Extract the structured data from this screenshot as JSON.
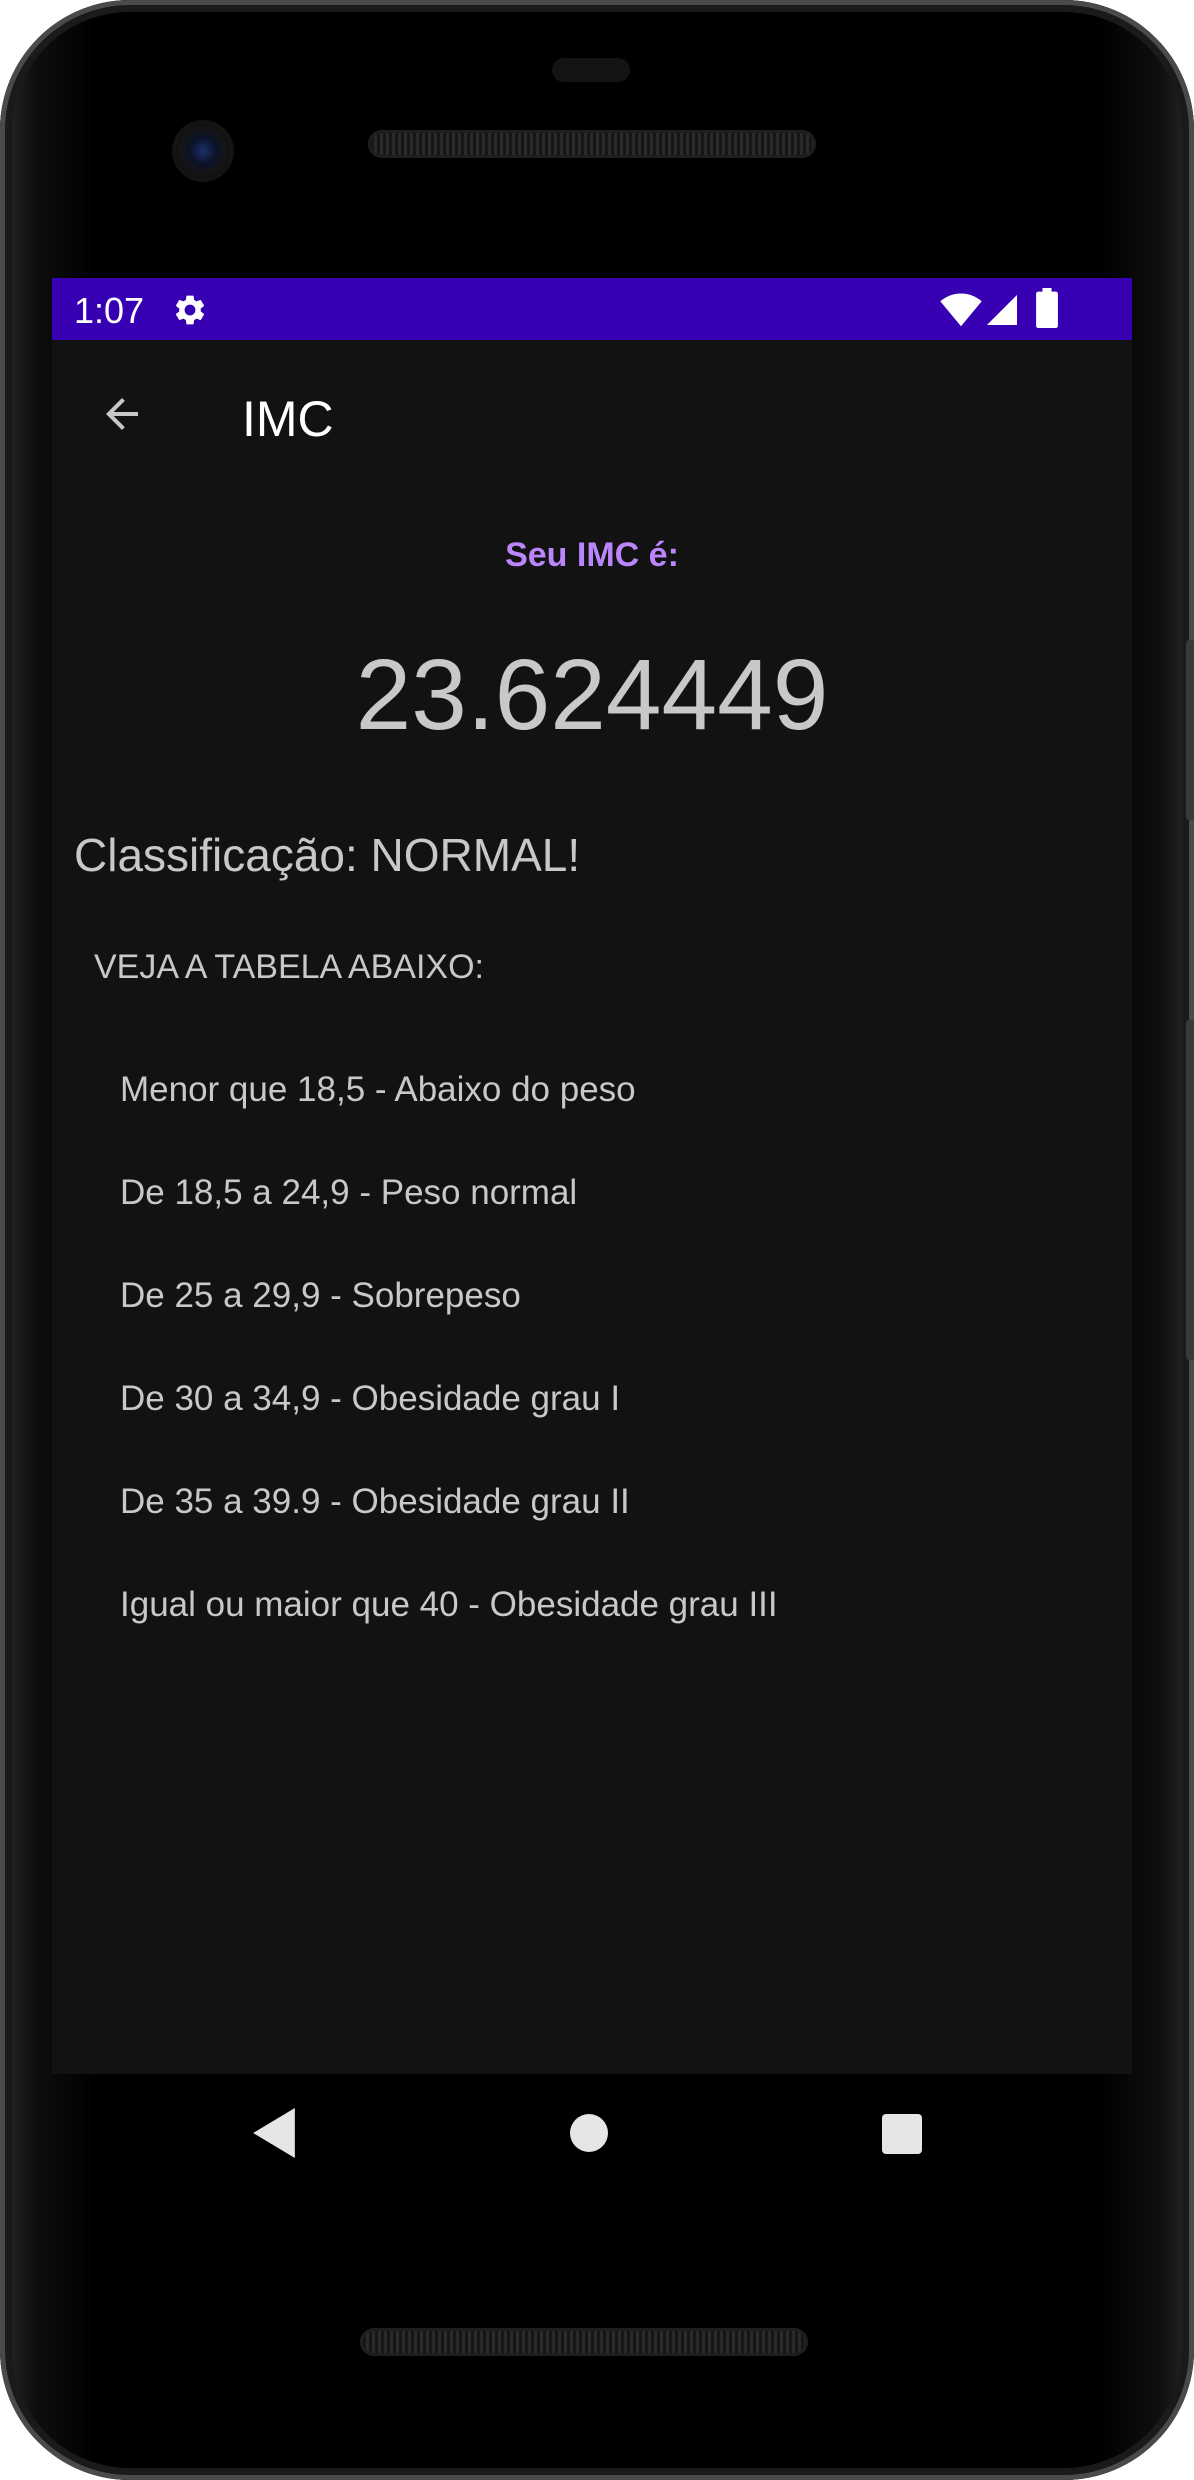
{
  "status_bar": {
    "time": "1:07"
  },
  "app_bar": {
    "title": "IMC"
  },
  "result": {
    "label": "Seu IMC é:",
    "value": "23.624449",
    "classification": "Classificação: NORMAL!"
  },
  "table": {
    "heading": "VEJA A TABELA ABAIXO:",
    "rows": [
      "Menor que 18,5 - Abaixo do peso",
      "De 18,5 a 24,9 - Peso normal",
      "De 25 a 29,9 - Sobrepeso",
      "De 30 a 34,9 - Obesidade grau I",
      "De 35 a 39.9 - Obesidade grau II",
      "Igual ou maior que 40 - Obesidade grau III"
    ]
  },
  "colors": {
    "status_bar": "#3700b3",
    "accent": "#bb86fc",
    "background": "#121212",
    "text": "#c8c8c8"
  },
  "icons": [
    "gear-icon",
    "wifi-icon",
    "signal-icon",
    "battery-icon",
    "back-arrow-icon",
    "nav-back-icon",
    "nav-home-icon",
    "nav-recents-icon"
  ]
}
